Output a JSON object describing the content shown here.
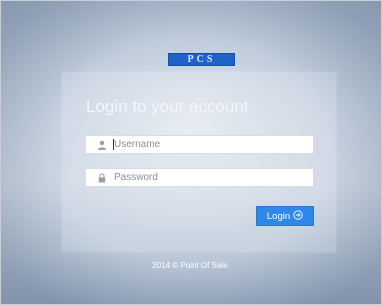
{
  "logo": {
    "text": "PCS"
  },
  "login": {
    "title": "Login to your account",
    "username_placeholder": "Username",
    "username_value": "",
    "password_placeholder": "Password",
    "password_value": "",
    "button_label": "Login",
    "button_icon": "arrow-circle-right-icon"
  },
  "footer": {
    "text": "2014 © Point Of Sale."
  },
  "colors": {
    "accent": "#2f87ea",
    "logo_bg": "#1f63c9",
    "panel_text": "#f4f6fa"
  }
}
